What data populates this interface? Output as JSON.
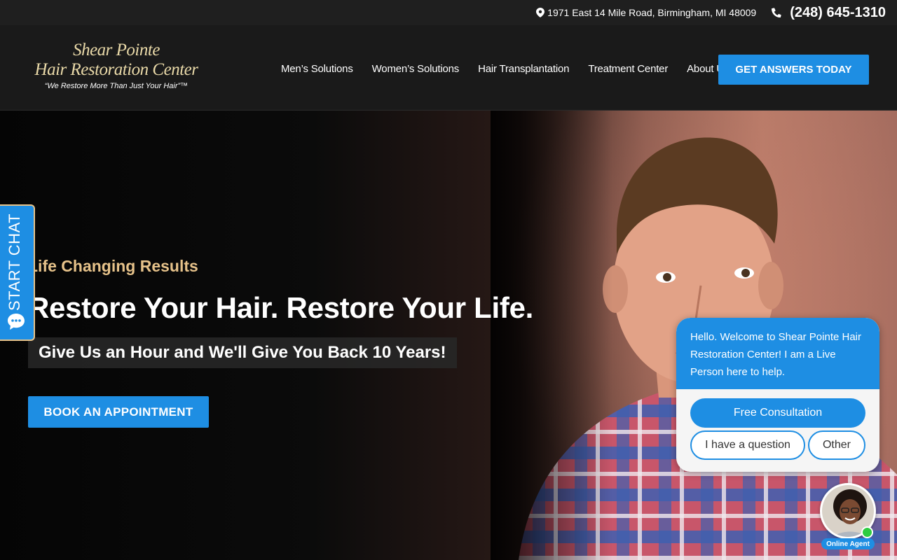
{
  "topbar": {
    "address": "1971 East 14 Mile Road, Birmingham, MI 48009",
    "phone": "(248) 645-1310",
    "address_icon": "map-pin-icon",
    "phone_icon": "phone-icon"
  },
  "logo": {
    "line1": "Shear Pointe",
    "line2": "Hair Restoration Center",
    "tagline": "“We Restore More Than Just Your Hair”™"
  },
  "nav": {
    "items": [
      {
        "label": "Men’s Solutions"
      },
      {
        "label": "Women’s Solutions"
      },
      {
        "label": "Hair Transplantation"
      },
      {
        "label": "Treatment Center"
      },
      {
        "label": "About Us"
      }
    ],
    "cta_label": "GET ANSWERS TODAY"
  },
  "hero": {
    "eyebrow": "Life Changing Results",
    "headline": "Restore Your Hair. Restore Your Life.",
    "subheadline": "Give Us an Hour and We'll Give You Back 10 Years!",
    "button_label": "BOOK AN APPOINTMENT"
  },
  "chat_tab": {
    "label": "START CHAT",
    "icon": "chat-bubble-icon"
  },
  "chat_widget": {
    "message": "Hello. Welcome to Shear Pointe Hair Restoration Center! I am a Live Person here to help.",
    "options": [
      "Free Consultation",
      "I have a question",
      "Other"
    ],
    "agent_label": "Online Agent"
  },
  "colors": {
    "accent_blue": "#1e8ee3",
    "gold": "#e6c28a",
    "online_green": "#2ecc40"
  }
}
